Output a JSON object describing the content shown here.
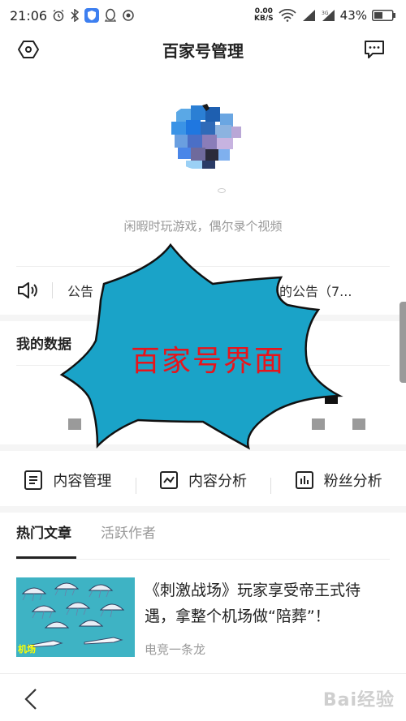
{
  "status_bar": {
    "time": "21:06",
    "net_speed_value": "0.00",
    "net_speed_unit": "KB/S",
    "battery": "43%"
  },
  "header": {
    "title": "百家号管理"
  },
  "profile": {
    "bio": "闲暇时玩游戏，偶尔录个视频"
  },
  "notice": {
    "label": "公告",
    "text_tail": "作弊账号的公告（7..."
  },
  "data_section": {
    "title": "我的数据"
  },
  "tools": [
    {
      "label": "内容管理",
      "icon": "document-icon"
    },
    {
      "label": "内容分析",
      "icon": "chart-line-icon"
    },
    {
      "label": "粉丝分析",
      "icon": "bar-chart-icon"
    }
  ],
  "tabs": [
    {
      "label": "热门文章",
      "active": true
    },
    {
      "label": "活跃作者",
      "active": false
    }
  ],
  "article": {
    "title": "《刺激战场》玩家享受帝王式待遇，拿整个机场做“陪葬”！",
    "author": "电竞一条龙",
    "thumb_tag": "机场"
  },
  "overlay": {
    "text": "百家号界面",
    "fill": "#1aa3c8",
    "text_color": "#e8141b"
  },
  "watermark": "Bai经验"
}
